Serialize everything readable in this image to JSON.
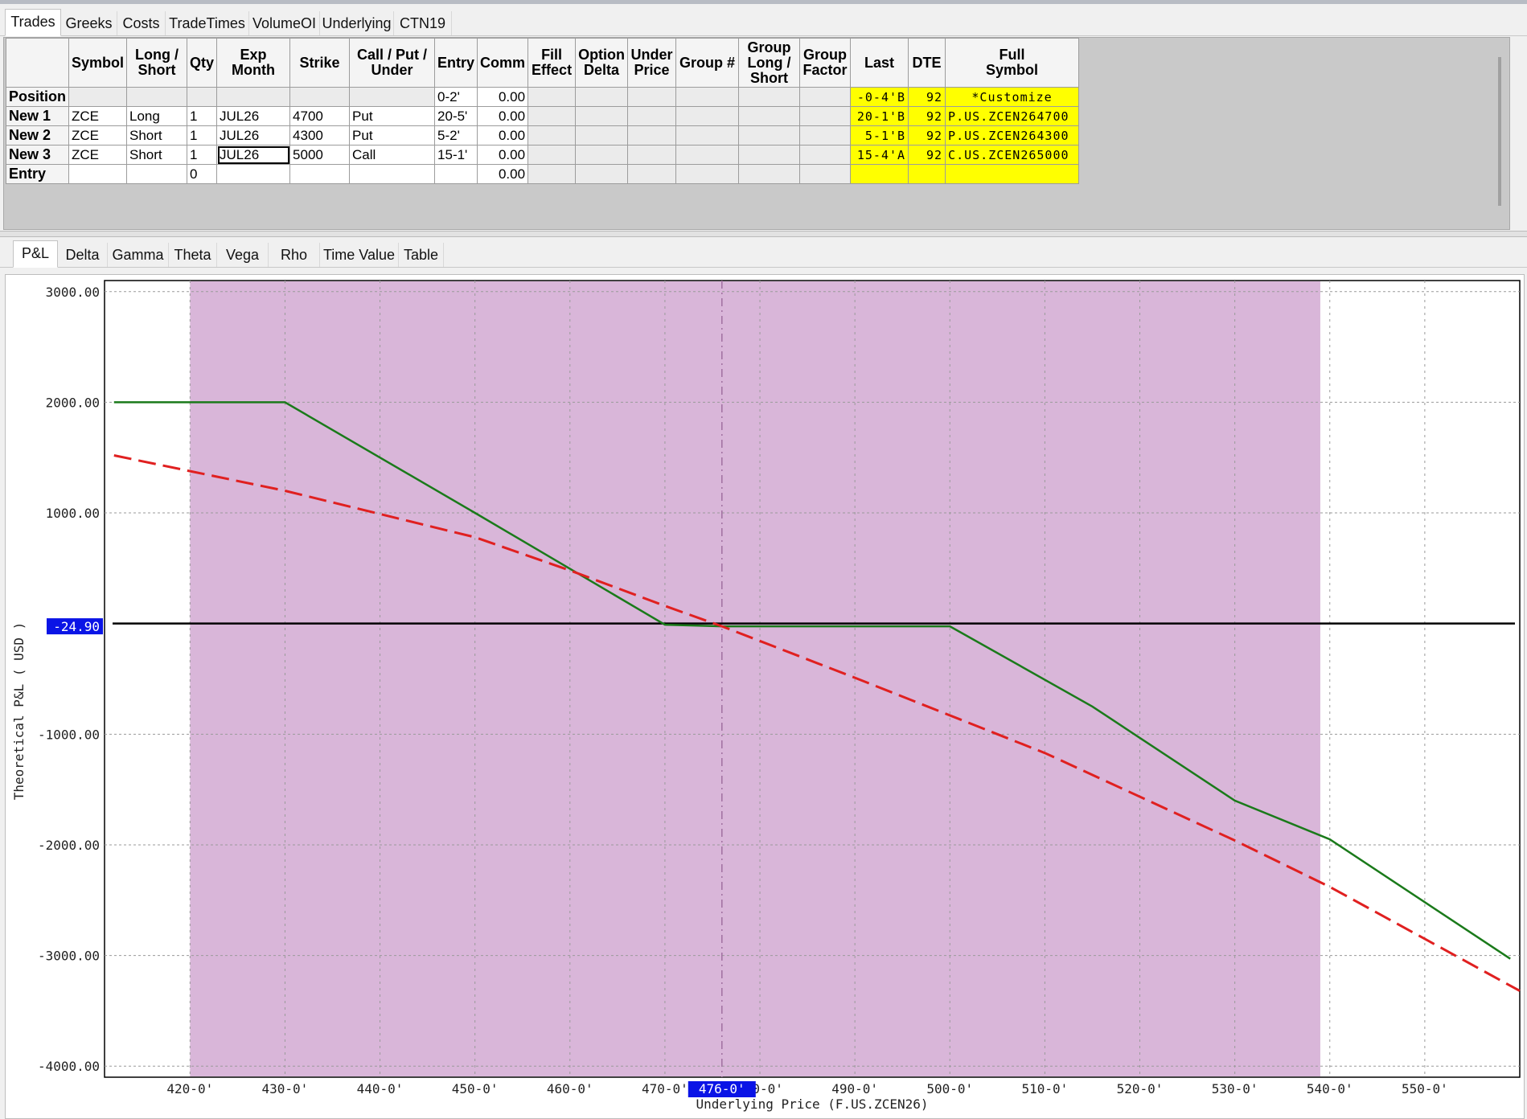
{
  "trades_tabs": [
    "Trades",
    "Greeks",
    "Costs",
    "TradeTimes",
    "VolumeOI",
    "Underlying",
    "CTN19"
  ],
  "chart_tabs": [
    "P&L",
    "Delta",
    "Gamma",
    "Theta",
    "Vega",
    "Rho",
    "Time Value",
    "Table"
  ],
  "columns": [
    {
      "l1": "",
      "l2": "",
      "l3": ""
    },
    {
      "l1": "Symbol",
      "l2": "",
      "l3": ""
    },
    {
      "l1": "Long /",
      "l2": "Short",
      "l3": ""
    },
    {
      "l1": "Qty",
      "l2": "",
      "l3": ""
    },
    {
      "l1": "Exp",
      "l2": "Month",
      "l3": ""
    },
    {
      "l1": "Strike",
      "l2": "",
      "l3": ""
    },
    {
      "l1": "Call / Put /",
      "l2": "Under",
      "l3": ""
    },
    {
      "l1": "Entry",
      "l2": "",
      "l3": ""
    },
    {
      "l1": "Comm",
      "l2": "",
      "l3": ""
    },
    {
      "l1": "Fill",
      "l2": "Effect",
      "l3": ""
    },
    {
      "l1": "Option",
      "l2": "Delta",
      "l3": ""
    },
    {
      "l1": "Under",
      "l2": "Price",
      "l3": ""
    },
    {
      "l1": "Group #",
      "l2": "",
      "l3": ""
    },
    {
      "l1": "Group",
      "l2": "Long /",
      "l3": "Short"
    },
    {
      "l1": "Group",
      "l2": "Factor",
      "l3": ""
    },
    {
      "l1": "Last",
      "l2": "",
      "l3": ""
    },
    {
      "l1": "DTE",
      "l2": "",
      "l3": ""
    },
    {
      "l1": "Full",
      "l2": "Symbol",
      "l3": ""
    }
  ],
  "rows": [
    {
      "label": "Position",
      "symbol": "",
      "long_short": "",
      "qty": "",
      "exp": "",
      "strike": "",
      "cpu": "",
      "entry": "0-2'",
      "comm": "0.00",
      "last": "-0-4'B",
      "dte": "92",
      "full": "*Customize"
    },
    {
      "label": "New 1",
      "symbol": "ZCE",
      "long_short": "Long",
      "qty": "1",
      "exp": "JUL26",
      "strike": "4700",
      "cpu": "Put",
      "entry": "20-5'",
      "comm": "0.00",
      "last": "20-1'B",
      "dte": "92",
      "full": "P.US.ZCEN264700"
    },
    {
      "label": "New 2",
      "symbol": "ZCE",
      "long_short": "Short",
      "qty": "1",
      "exp": "JUL26",
      "strike": "4300",
      "cpu": "Put",
      "entry": "5-2'",
      "comm": "0.00",
      "last": "5-1'B",
      "dte": "92",
      "full": "P.US.ZCEN264300"
    },
    {
      "label": "New 3",
      "symbol": "ZCE",
      "long_short": "Short",
      "qty": "1",
      "exp": "JUL26",
      "strike": "5000",
      "cpu": "Call",
      "entry": "15-1'",
      "comm": "0.00",
      "last": "15-4'A",
      "dte": "92",
      "full": "C.US.ZCEN265000"
    },
    {
      "label": "Entry",
      "symbol": "",
      "long_short": "",
      "qty": "0",
      "exp": "",
      "strike": "",
      "cpu": "",
      "entry": "",
      "comm": "0.00",
      "last": "",
      "dte": "",
      "full": ""
    }
  ],
  "chart_data": {
    "type": "line",
    "ylabel": "Theoretical P&L ( USD )",
    "xlabel": "Underlying Price (F.US.ZCEN26)",
    "xlim": [
      411,
      560
    ],
    "ylim": [
      -4100,
      3100
    ],
    "y_ticks": [
      3000,
      2000,
      1000,
      -1000,
      -2000,
      -3000,
      -4000
    ],
    "y_tick_labels": [
      "3000.00",
      "2000.00",
      "1000.00",
      "-1000.00",
      "-2000.00",
      "-3000.00",
      "-4000.00"
    ],
    "x_ticks": [
      420,
      430,
      440,
      450,
      460,
      470,
      480,
      490,
      500,
      510,
      520,
      530,
      540,
      550
    ],
    "x_tick_labels": [
      "420-0'",
      "430-0'",
      "440-0'",
      "450-0'",
      "460-0'",
      "470-0'",
      "480-0'",
      "490-0'",
      "500-0'",
      "510-0'",
      "520-0'",
      "530-0'",
      "540-0'",
      "550-0'"
    ],
    "current_price": 476,
    "current_price_label": "476-0'",
    "current_pnl": -24.9,
    "current_pnl_label": "-24.90",
    "shaded_range": [
      420,
      539
    ],
    "series": [
      {
        "style": "expiration",
        "color": "#1a7a1a",
        "x": [
          412,
          430,
          450,
          470,
          476,
          500,
          515,
          530,
          540,
          559
        ],
        "y": [
          2000,
          2000,
          1000,
          -10,
          -25,
          -25,
          -750,
          -1600,
          -1950,
          -3030
        ]
      },
      {
        "style": "current",
        "color": "#e02020",
        "x": [
          412,
          430,
          450,
          460,
          470,
          476,
          490,
          510,
          530,
          540,
          560
        ],
        "y": [
          1520,
          1200,
          780,
          480,
          160,
          -25,
          -490,
          -1170,
          -1960,
          -2380,
          -3320
        ]
      }
    ],
    "zero_line_color": "#000000",
    "shade_color": "#d9b6d9"
  }
}
